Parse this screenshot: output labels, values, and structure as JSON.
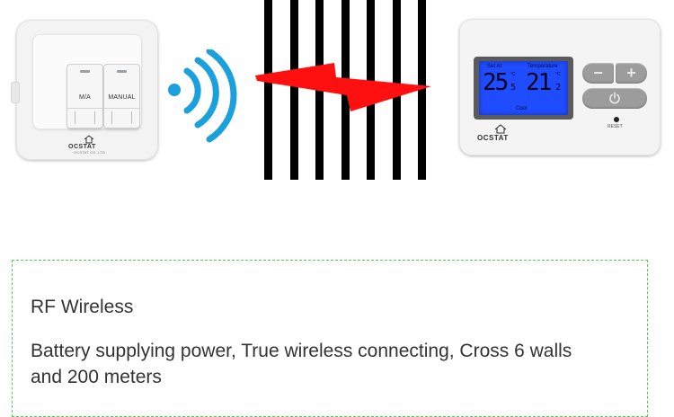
{
  "receiver": {
    "switch_left_label": "M/A",
    "switch_right_label": "MANUAL",
    "brand": "OCSTAT",
    "brand_subtext": "OCSTAT CO.,LTD"
  },
  "thermostat": {
    "set_at_label": "Set At",
    "temperature_label": "Temperature",
    "set_value_main": "25",
    "set_value_decimal": "5",
    "temp_value_main": "21",
    "temp_value_decimal": "2",
    "unit": "°C",
    "mode": "Cool",
    "minus_label": "−",
    "plus_label": "+",
    "reset_label": "RESET",
    "brand": "OCSTAT",
    "lcd_color": "#1f4cff"
  },
  "graphic": {
    "wave_color": "#1aa0dd",
    "bolt_color": "#ff1010",
    "barrier_color": "#000000"
  },
  "info": {
    "title": "RF Wireless",
    "body": "Battery supplying power, True wireless connecting, Cross 6 walls and 200 meters",
    "border_color": "#4fd14f"
  }
}
